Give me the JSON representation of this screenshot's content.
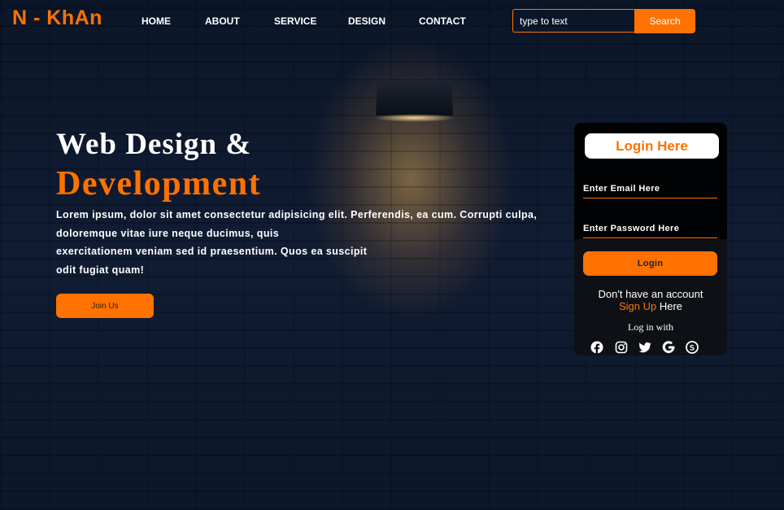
{
  "brand": {
    "logo": "N - KhAn",
    "accent_color": "#ff7200"
  },
  "nav": {
    "items": [
      "HOME",
      "ABOUT",
      "SERVICE",
      "DESIGN",
      "CONTACT"
    ]
  },
  "search": {
    "placeholder": "type to text",
    "button_label": "Search"
  },
  "hero": {
    "title_line1": "Web Design &",
    "title_line2": "Development",
    "paragraph_lines": [
      "Lorem ipsum, dolor sit amet consectetur adipisicing elit. Perferendis, ea cum. Corrupti culpa,",
      "doloremque vitae iure neque ducimus, quis",
      "exercitationem veniam sed id praesentium. Quos ea suscipit",
      "odit fugiat quam!"
    ],
    "join_label": "Join Us"
  },
  "login": {
    "title": "Login Here",
    "email_placeholder": "Enter Email Here",
    "password_placeholder": "Enter Password Here",
    "button_label": "Login",
    "no_account_text": "Don't have an account",
    "signup_link": "Sign Up",
    "signup_suffix": " Here",
    "login_with_text": "Log in with",
    "social_icons": [
      "facebook-icon",
      "instagram-icon",
      "twitter-icon",
      "google-icon",
      "skype-icon"
    ]
  }
}
